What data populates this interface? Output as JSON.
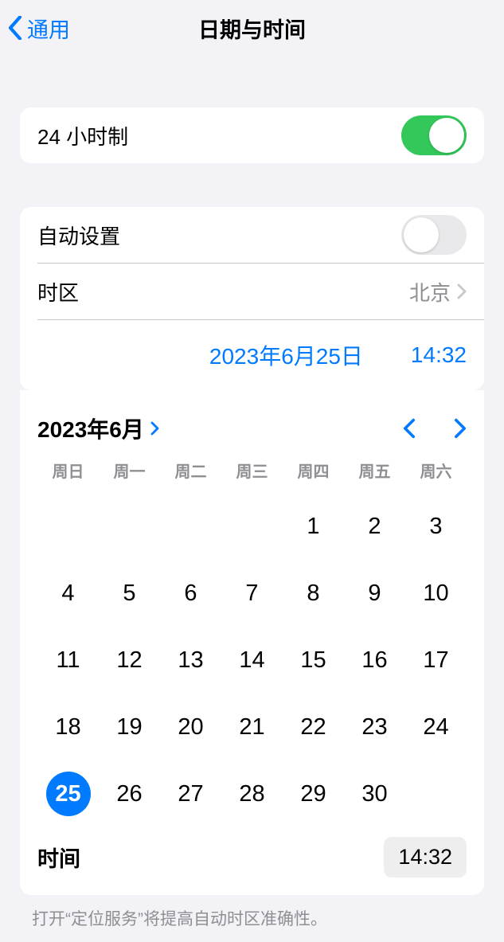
{
  "header": {
    "back_label": "通用",
    "title": "日期与时间"
  },
  "rows": {
    "twenty_four_hour": "24 小时制",
    "auto_set": "自动设置",
    "timezone_label": "时区",
    "timezone_value": "北京",
    "selected_date": "2023年6月25日",
    "selected_time": "14:32"
  },
  "calendar": {
    "month_label": "2023年6月",
    "weekdays": [
      "周日",
      "周一",
      "周二",
      "周三",
      "周四",
      "周五",
      "周六"
    ],
    "first_weekday": 4,
    "days_in_month": 30,
    "selected_day": 25,
    "time_label": "时间",
    "time_value": "14:32"
  },
  "footer": "打开“定位服务”将提高自动时区准确性。"
}
